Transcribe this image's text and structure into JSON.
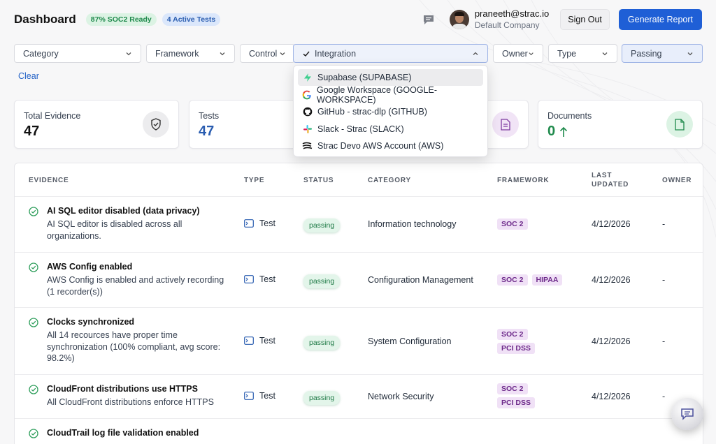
{
  "header": {
    "title": "Dashboard",
    "soc2_badge": "87% SOC2 Ready",
    "tests_badge": "4 Active Tests",
    "user_email": "praneeth@strac.io",
    "user_company": "Default Company",
    "sign_out": "Sign Out",
    "generate_report": "Generate Report"
  },
  "filters": {
    "category": "Category",
    "framework": "Framework",
    "control": "Control",
    "integration": "Integration",
    "owner": "Owner",
    "type": "Type",
    "status": "Passing",
    "clear": "Clear"
  },
  "integration_dropdown": [
    {
      "label": "Supabase (SUPABASE)",
      "icon": "supabase-icon",
      "color": "#3ecf8e"
    },
    {
      "label": "Google Workspace (GOOGLE-WORKSPACE)",
      "icon": "google-icon",
      "color": "#4285f4"
    },
    {
      "label": "GitHub - strac-dlp (GITHUB)",
      "icon": "github-icon",
      "color": "#111111"
    },
    {
      "label": "Slack - Strac (SLACK)",
      "icon": "slack-icon",
      "color": "#e01e5a"
    },
    {
      "label": "Strac Devo AWS Account (AWS)",
      "icon": "aws-icon",
      "color": "#111111"
    }
  ],
  "cards": {
    "evidence": {
      "label": "Total Evidence",
      "value": "47"
    },
    "tests": {
      "label": "Tests",
      "value": "47"
    },
    "documents": {
      "label": "Documents",
      "value": "0"
    }
  },
  "table": {
    "headers": {
      "evidence": "EVIDENCE",
      "type": "TYPE",
      "status": "STATUS",
      "category": "CATEGORY",
      "framework": "FRAMEWORK",
      "last_updated_1": "LAST",
      "last_updated_2": "UPDATED",
      "owner": "OWNER"
    },
    "rows": [
      {
        "title": "AI SQL editor disabled (data privacy)",
        "desc": "AI SQL editor is disabled across all organizations.",
        "type": "Test",
        "status": "passing",
        "category": "Information technology",
        "frameworks": [
          "SOC 2"
        ],
        "updated": "4/12/2026",
        "owner": "-"
      },
      {
        "title": "AWS Config enabled",
        "desc": "AWS Config is enabled and actively recording (1 recorder(s))",
        "type": "Test",
        "status": "passing",
        "category": "Configuration Management",
        "frameworks": [
          "SOC 2",
          "HIPAA"
        ],
        "updated": "4/12/2026",
        "owner": "-"
      },
      {
        "title": "Clocks synchronized",
        "desc": "All 14 recources have proper time synchronization (100% compliant, avg score: 98.2%)",
        "type": "Test",
        "status": "passing",
        "category": "System Configuration",
        "frameworks": [
          "SOC 2",
          "PCI DSS"
        ],
        "updated": "4/12/2026",
        "owner": "-"
      },
      {
        "title": "CloudFront distributions use HTTPS",
        "desc": "All CloudFront distributions enforce HTTPS",
        "type": "Test",
        "status": "passing",
        "category": "Network Security",
        "frameworks": [
          "SOC 2",
          "PCI DSS"
        ],
        "updated": "4/12/2026",
        "owner": "-"
      },
      {
        "title": "CloudTrail log file validation enabled",
        "desc": "",
        "type": "",
        "status": "",
        "category": "",
        "frameworks": [],
        "updated": "",
        "owner": ""
      }
    ]
  },
  "colors": {
    "accent": "#1f5fd6",
    "passing_green": "#1f7a46",
    "framework_purple": "#6d2a8a"
  }
}
